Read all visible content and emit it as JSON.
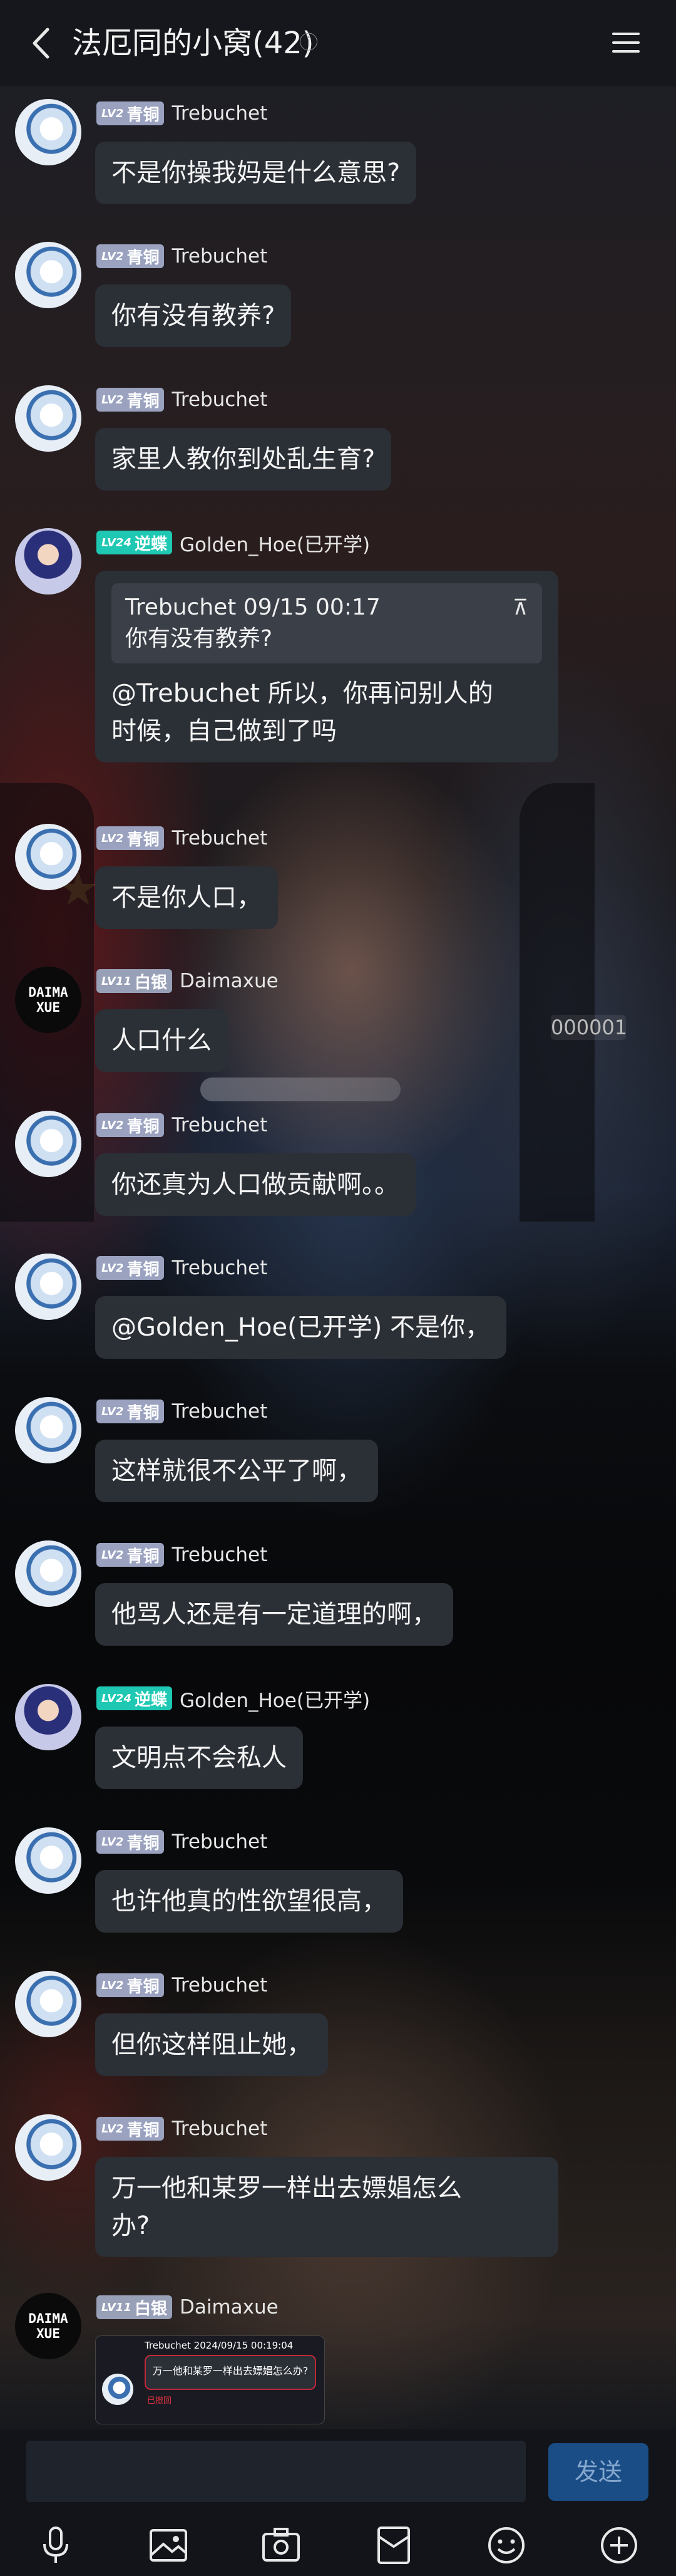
{
  "header": {
    "title": "法厄同的小窝(42)"
  },
  "levels": {
    "bronze": "青铜",
    "butterfly": "逆蝶",
    "silver": "白银",
    "lv2": "LV2",
    "lv24": "LV24",
    "lv11": "LV11"
  },
  "users": {
    "trebuchet": "Trebuchet",
    "golden": "Golden_Hoe(已开学)",
    "daima": "Daimaxue",
    "daima_logo_1": "DAIMA",
    "daima_logo_2": "XUE"
  },
  "messages": [
    {
      "text": "不是你操我妈是什么意思?"
    },
    {
      "text": "你有没有教养?"
    },
    {
      "text": "家里人教你到处乱生育?"
    },
    {
      "quote_head": "Trebuchet 09/15 00:17",
      "quote_text": "你有没有教养?",
      "text_line1": "@Trebuchet 所以，你再问别人的",
      "text_line2": "时候，自己做到了吗"
    },
    {
      "text": "不是你人口，"
    },
    {
      "text": "人口什么"
    },
    {
      "text": "你还真为人口做贡献啊。。"
    },
    {
      "text": "@Golden_Hoe(已开学) 不是你，"
    },
    {
      "text": "这样就很不公平了啊，"
    },
    {
      "text": "他骂人还是有一定道理的啊，"
    },
    {
      "text": "文明点不会私人"
    },
    {
      "text": "也许他真的性欲望很高，"
    },
    {
      "text": "但你这样阻止她，"
    },
    {
      "text_line1": "万一他和某罗一样出去嫖娼怎么",
      "text_line2": "办?"
    },
    {
      "image_head": "Trebuchet 2024/09/15 00:19:04",
      "image_text": "万一他和某罗一样出去嫖娼怎么办?",
      "image_note": "已撤回"
    }
  ],
  "background": {
    "badge_number": "000001"
  },
  "input": {
    "send_label": "发送"
  },
  "colors": {
    "bubble": "#2b2f36",
    "bronze_badge": "#9aa2c0",
    "butterfly_badge": "#1fc8b3",
    "send_button": "#1a4d86"
  },
  "toolbar": {
    "icons": [
      "mic-icon",
      "image-icon",
      "camera-icon",
      "red-packet-icon",
      "emoji-icon",
      "plus-icon"
    ]
  }
}
